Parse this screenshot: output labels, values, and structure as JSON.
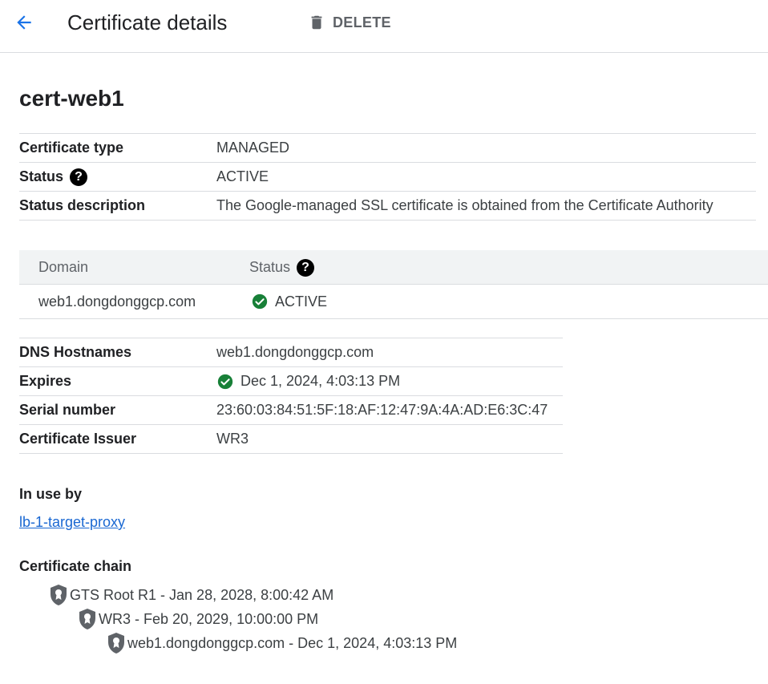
{
  "header": {
    "title": "Certificate details",
    "delete_label": "DELETE"
  },
  "cert": {
    "name": "cert-web1"
  },
  "summary": [
    {
      "key": "Certificate type",
      "value": "MANAGED"
    },
    {
      "key": "Status",
      "value": "ACTIVE"
    },
    {
      "key": "Status description",
      "value": "The Google-managed SSL certificate is obtained from the Certificate Authority"
    }
  ],
  "domains": {
    "columns": [
      "Domain",
      "Status"
    ],
    "rows": [
      {
        "domain": "web1.dongdonggcp.com",
        "status": "ACTIVE"
      }
    ]
  },
  "details": [
    {
      "key": "DNS Hostnames",
      "value": "web1.dongdonggcp.com"
    },
    {
      "key": "Expires",
      "value": "Dec 1, 2024, 4:03:13 PM"
    },
    {
      "key": "Serial number",
      "value": "23:60:03:84:51:5F:18:AF:12:47:9A:4A:AD:E6:3C:47"
    },
    {
      "key": "Certificate Issuer",
      "value": "WR3"
    }
  ],
  "in_use": {
    "label": "In use by",
    "link": "lb-1-target-proxy"
  },
  "chain": {
    "label": "Certificate chain",
    "items": [
      "GTS Root R1 - Jan 28, 2028, 8:00:42 AM",
      "WR3 - Feb 20, 2029, 10:00:00 PM",
      "web1.dongdonggcp.com - Dec 1, 2024, 4:03:13 PM"
    ]
  },
  "colors": {
    "accent_blue": "#1a73e8",
    "success_green": "#188038",
    "text_primary": "#202124",
    "text_secondary": "#3c4043",
    "divider": "#dadce0"
  },
  "icons": {
    "back": "arrow-back-icon",
    "delete": "trash-icon",
    "help": "help-circle-icon",
    "check": "check-circle-icon",
    "certificate": "cert-shield-icon"
  }
}
